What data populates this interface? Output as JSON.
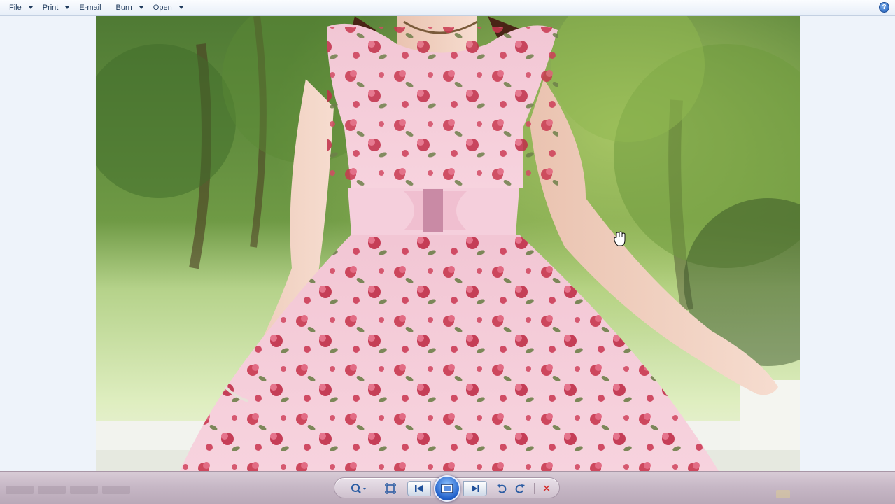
{
  "menu": {
    "items": [
      {
        "label": "File",
        "has_dropdown": true
      },
      {
        "label": "Print",
        "has_dropdown": true
      },
      {
        "label": "E-mail",
        "has_dropdown": false
      },
      {
        "label": "Burn",
        "has_dropdown": true
      },
      {
        "label": "Open",
        "has_dropdown": true
      }
    ],
    "help_icon": "help-icon",
    "help_glyph": "?"
  },
  "viewer": {
    "photo_icon": "photo-image"
  },
  "controls": {
    "icons": [
      "zoom-icon",
      "fit-window-icon",
      "previous-icon",
      "slideshow-icon",
      "next-icon",
      "rotate-ccw-icon",
      "rotate-cw-icon",
      "delete-icon"
    ],
    "delete_glyph": "✕"
  },
  "colors": {
    "menubar": "#eef3fa",
    "menu_text": "#1e395b",
    "controlbar": "#c7b8c6",
    "accent": "#1f5fc9",
    "delete": "#d42b2b"
  }
}
